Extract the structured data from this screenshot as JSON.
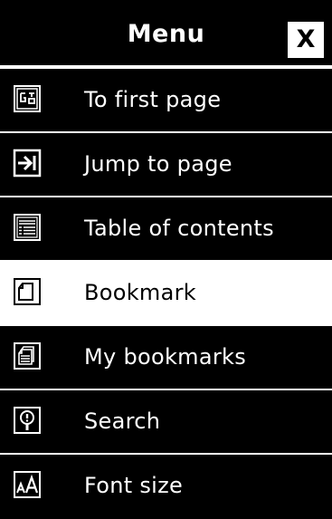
{
  "header": {
    "title": "Menu",
    "close_label": "X"
  },
  "items": [
    {
      "label": "To first page",
      "icon": "first-page-icon",
      "selected": false
    },
    {
      "label": "Jump to page",
      "icon": "jump-to-page-icon",
      "selected": false
    },
    {
      "label": "Table of contents",
      "icon": "table-of-contents-icon",
      "selected": false
    },
    {
      "label": "Bookmark",
      "icon": "bookmark-icon",
      "selected": true
    },
    {
      "label": "My bookmarks",
      "icon": "my-bookmarks-icon",
      "selected": false
    },
    {
      "label": "Search",
      "icon": "search-icon",
      "selected": false
    },
    {
      "label": "Font size",
      "icon": "font-size-icon",
      "selected": false
    }
  ],
  "colors": {
    "background": "#000000",
    "foreground": "#ffffff",
    "selected_background": "#ffffff",
    "selected_foreground": "#000000"
  }
}
